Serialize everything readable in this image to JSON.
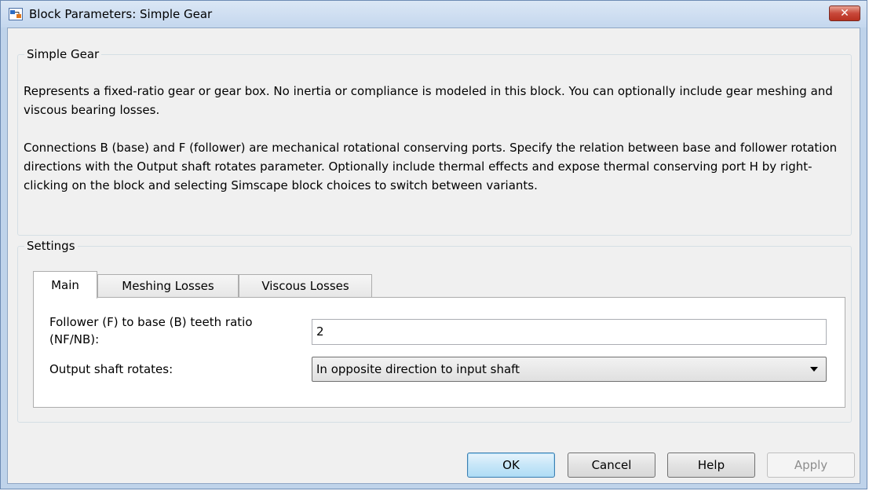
{
  "window": {
    "title": "Block Parameters: Simple Gear",
    "close_label": "✕"
  },
  "block_group": {
    "legend": "Simple Gear",
    "description_1": "Represents a fixed-ratio gear or gear box. No inertia or compliance is modeled in this block. You can optionally include gear meshing and viscous bearing losses.",
    "description_2": "Connections B (base) and F (follower) are mechanical rotational conserving ports. Specify the relation between base and follower rotation directions with the Output shaft rotates parameter. Optionally include thermal effects and expose thermal conserving port H by right-clicking on the block and selecting Simscape block choices to switch between variants."
  },
  "settings_group": {
    "legend": "Settings",
    "tabs": [
      {
        "label": "Main",
        "active": true
      },
      {
        "label": "Meshing Losses",
        "active": false
      },
      {
        "label": "Viscous Losses",
        "active": false
      }
    ],
    "main": {
      "teeth_ratio_label_line1": "Follower (F) to base (B) teeth ratio",
      "teeth_ratio_label_line2": "(NF/NB):",
      "teeth_ratio_value": "2",
      "output_shaft_label": "Output shaft rotates:",
      "output_shaft_value": "In opposite direction to input shaft"
    }
  },
  "buttons": {
    "ok": "OK",
    "cancel": "Cancel",
    "help": "Help",
    "apply": "Apply"
  },
  "colors": {
    "title_bar": "#c4d7ee",
    "close_button": "#c8483a",
    "dialog_bg": "#f0f0f0",
    "default_button": "#c7e6f8"
  }
}
